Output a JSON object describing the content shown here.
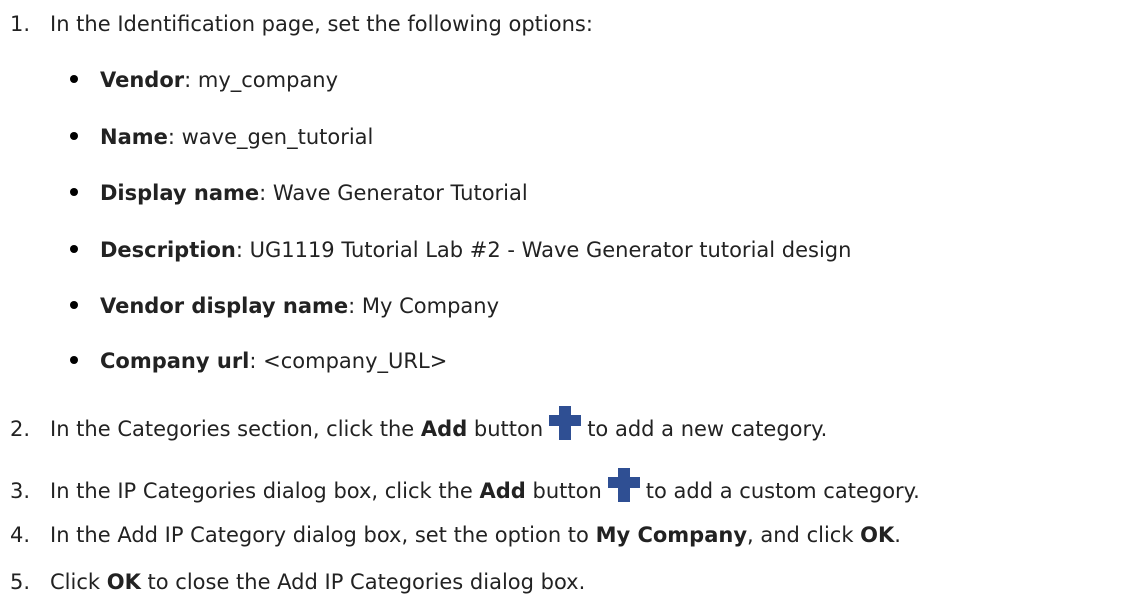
{
  "step1": {
    "number": "1.",
    "text": "In the Identification page, set the following options:"
  },
  "bullets": [
    {
      "label": "Vendor",
      "sep": ":",
      "value": " my_company"
    },
    {
      "label": "Name",
      "sep": ":",
      "value": " wave_gen_tutorial"
    },
    {
      "label": "Display name",
      "sep": ":",
      "value": " Wave Generator Tutorial"
    },
    {
      "label": "Description",
      "sep": ":",
      "value": " UG1119 Tutorial Lab #2 - Wave Generator tutorial design"
    },
    {
      "label": "Vendor display name",
      "sep": ":",
      "value": " My Company"
    },
    {
      "label": "Company url",
      "sep": ":",
      "value": " <company_URL>"
    }
  ],
  "step2": {
    "number": "2.",
    "pre": "In the Categories section, click the ",
    "bold": "Add",
    "mid": " button",
    "post": "to add a new category.",
    "icon": "plus-icon",
    "icon_color": "#2f4f93"
  },
  "step3": {
    "number": "3.",
    "pre": "In the IP Categories dialog box, click the ",
    "bold": "Add",
    "mid": " button",
    "post": "to add a custom category.",
    "icon": "plus-icon",
    "icon_color": "#2f4f93"
  },
  "step4": {
    "number": "4.",
    "pre": "In the Add IP Category dialog box, set the option to ",
    "bold1": "My Company",
    "mid": ", and click ",
    "bold2": "OK",
    "post": "."
  },
  "step5": {
    "number": "5.",
    "pre": "Click ",
    "bold": "OK",
    "post": " to close the Add IP Categories dialog box."
  }
}
